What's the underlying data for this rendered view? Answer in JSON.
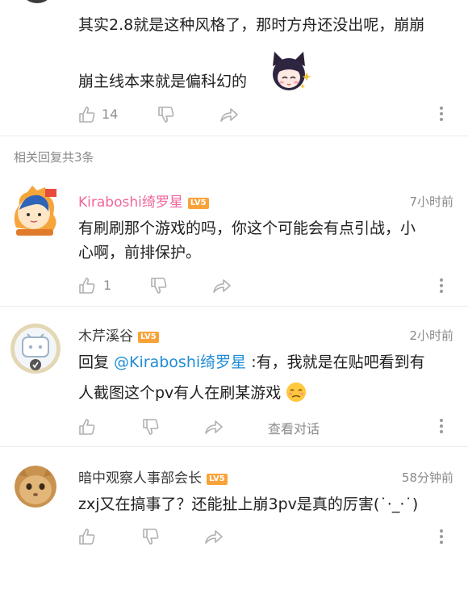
{
  "top_comment": {
    "line1": "其实2.8就是这种风格了，那时方舟还没出呢，崩崩",
    "line2": "崩主线本来就是偏科幻的",
    "like_count": "14"
  },
  "replies_header": "相关回复共3条",
  "replies": [
    {
      "name": "Kiraboshi绮罗星",
      "level": "LV5",
      "time": "7小时前",
      "line1": "有刷刷那个游戏的吗，你这个可能会有点引战，小",
      "line2": "心啊，前排保护。",
      "like_count": "1"
    },
    {
      "name": "木芹溪谷",
      "level": "LV5",
      "time": "2小时前",
      "reply_prefix": "回复 ",
      "mention": "@Kiraboshi绮罗星",
      "line1_rest": " :有，我就是在贴吧看到有",
      "line2": "人截图这个pv有人在刷某游戏",
      "view_conversation": "查看对话"
    },
    {
      "name": "暗中观察人事部会长",
      "level": "LV5",
      "time": "58分钟前",
      "line1": "zxj又在搞事了？还能扯上崩3pv是真的厉害(˙·_·˙)"
    }
  ],
  "colors": {
    "accent_name": "#f0669b",
    "link": "#1f8dd6",
    "level_badge": "#f8a33a",
    "icon_gray": "#b0b0b0"
  }
}
